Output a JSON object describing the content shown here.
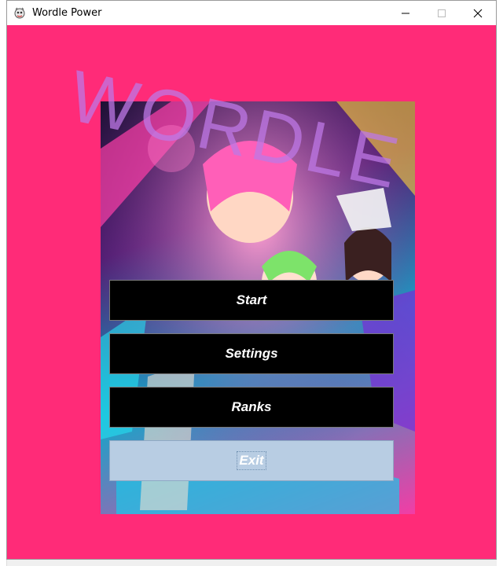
{
  "window": {
    "title": "Wordle Power",
    "icon": "game-controller-icon"
  },
  "controls": {
    "minimize": "minimize-icon",
    "maximize": "maximize-icon",
    "close": "close-icon"
  },
  "colors": {
    "background": "#ff2b78",
    "button_bg": "#000000",
    "button_text": "#ffffff",
    "exit_bg": "#b8cde3",
    "title_overlay": "#be78e6"
  },
  "main": {
    "title_overlay": "WORDLE",
    "buttons": [
      {
        "label": "Start"
      },
      {
        "label": "Settings"
      },
      {
        "label": "Ranks"
      },
      {
        "label": "Exit"
      }
    ]
  }
}
